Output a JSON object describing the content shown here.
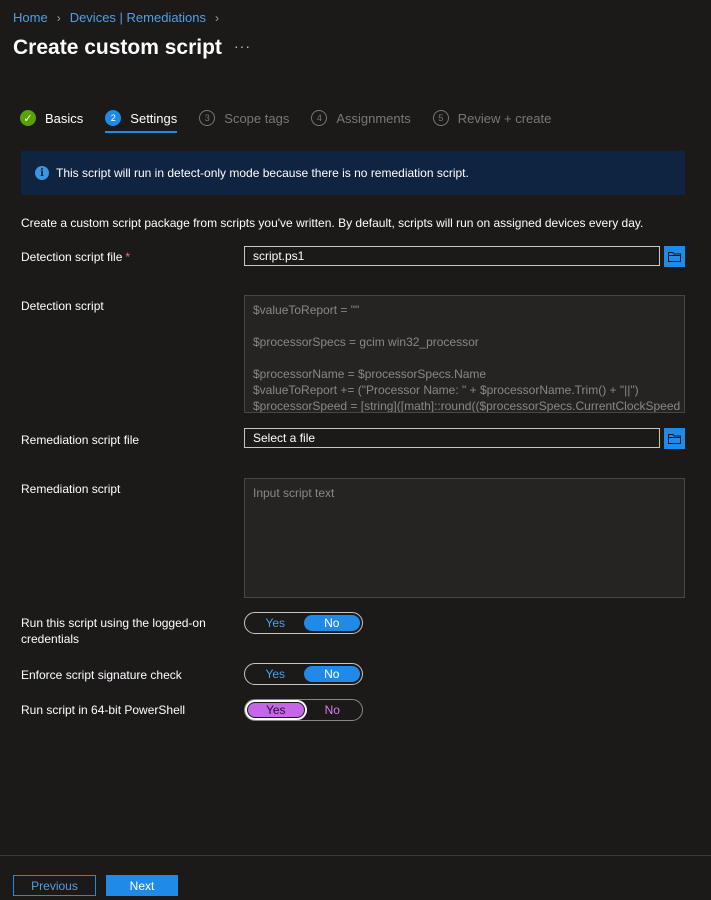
{
  "breadcrumb": {
    "home": "Home",
    "section": "Devices | Remediations"
  },
  "title": "Create custom script",
  "more_label": "···",
  "steps": [
    {
      "num": "✓",
      "label": "Basics"
    },
    {
      "num": "2",
      "label": "Settings"
    },
    {
      "num": "3",
      "label": "Scope tags"
    },
    {
      "num": "4",
      "label": "Assignments"
    },
    {
      "num": "5",
      "label": "Review + create"
    }
  ],
  "banner": {
    "icon": "i",
    "text": "This script will run in detect-only mode because there is no remediation script."
  },
  "description": "Create a custom script package from scripts you've written. By default, scripts will run on assigned devices every day.",
  "detection_file": {
    "label": "Detection script file",
    "required_mark": "*",
    "value": "script.ps1"
  },
  "detection_script": {
    "label": "Detection script",
    "text": "$valueToReport = \"\"\n\n$processorSpecs = gcim win32_processor\n\n$processorName = $processorSpecs.Name\n$valueToReport += (\"Processor Name: \" + $processorName.Trim() + \"||\")\n$processorSpeed = [string]([math]::round(($processorSpecs.CurrentClockSpeed"
  },
  "remediation_file": {
    "label": "Remediation script file",
    "value": "Select a file"
  },
  "remediation_script": {
    "label": "Remediation script",
    "placeholder": "Input script text"
  },
  "toggles": [
    {
      "label": "Run this script using the logged-on credentials",
      "yes": "Yes",
      "no": "No",
      "selected": "No"
    },
    {
      "label": "Enforce script signature check",
      "yes": "Yes",
      "no": "No",
      "selected": "No"
    },
    {
      "label": "Run script in 64-bit PowerShell",
      "yes": "Yes",
      "no": "No",
      "selected": "Yes"
    }
  ],
  "footer": {
    "previous": "Previous",
    "next": "Next"
  },
  "colors": {
    "accent": "#1f8ae8",
    "highlight": "#c566e8",
    "success": "#57a300"
  }
}
